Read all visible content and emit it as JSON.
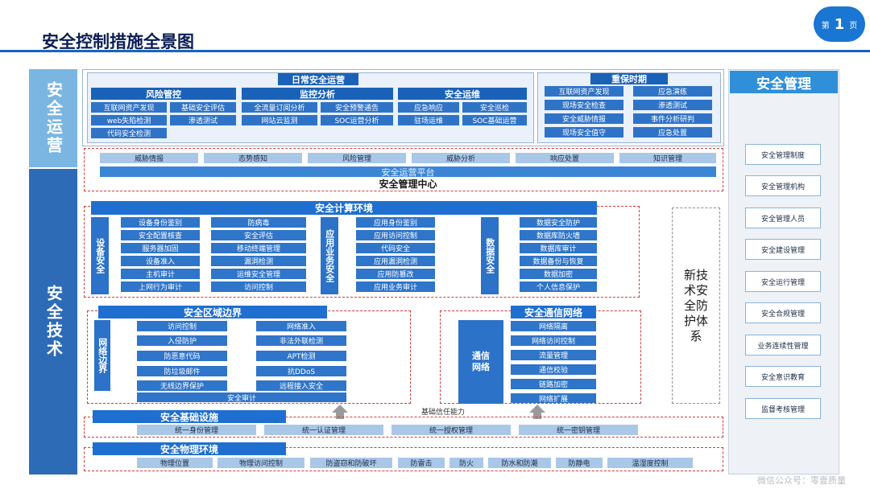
{
  "header": {
    "title": "安全控制措施全景图",
    "page_prefix": "第",
    "page_num": "1",
    "page_suffix": "页"
  },
  "bands": {
    "ops": "安全运营",
    "tech": "安全技术"
  },
  "daily_ops": {
    "title": "日常安全运营",
    "groups": [
      {
        "name": "风险管控",
        "items": [
          "互联网资产发现",
          "基础安全评估",
          "web失陷检测",
          "渗透测试",
          "代码安全检测"
        ]
      },
      {
        "name": "监控分析",
        "items": [
          "全流量订阅分析",
          "安全预警通告",
          "网站云监测",
          "SOC运营分析"
        ]
      },
      {
        "name": "安全运维",
        "items": [
          "应急响应",
          "安全巡检",
          "驻场运维",
          "SOC基础运营"
        ]
      }
    ]
  },
  "key_period": {
    "title": "重保时期",
    "items": [
      "互联网资产发现",
      "应急演练",
      "现场安全检查",
      "渗透测试",
      "安全威胁情报",
      "事件分析研判",
      "现场安全值守",
      "应急处置"
    ]
  },
  "soc": {
    "top_items": [
      "威胁情报",
      "态势感知",
      "风险管理",
      "威胁分析",
      "响应处置",
      "知识管理"
    ],
    "platform": "安全运营平台",
    "center": "安全管理中心"
  },
  "compute": {
    "title": "安全计算环境",
    "device": {
      "label": "设备安全",
      "col1": [
        "设备身份鉴别",
        "安全配置核查",
        "服务器加固",
        "设备准入",
        "主机审计",
        "上网行为审计"
      ],
      "col2": [
        "防病毒",
        "安全评估",
        "移动终端管理",
        "漏洞检测",
        "运维安全管理",
        "访问控制"
      ]
    },
    "app": {
      "label": "应用业务安全",
      "items": [
        "应用身份鉴别",
        "应用访问控制",
        "代码安全",
        "应用漏洞检测",
        "应用防篡改",
        "应用业务审计"
      ]
    },
    "data": {
      "label": "数据安全",
      "items": [
        "数据安全防护",
        "数据库防火墙",
        "数据库审计",
        "数据备份与恢复",
        "数据加密",
        "个人信息保护"
      ]
    }
  },
  "new_tech": "新技术安全防护体系",
  "border": {
    "title": "安全区域边界",
    "label": "网络边界",
    "col1": [
      "访问控制",
      "入侵防护",
      "防恶意代码",
      "防垃圾邮件",
      "无线边界保护"
    ],
    "col2": [
      "网络准入",
      "非法外联检测",
      "APT检测",
      "抗DDoS",
      "远程接入安全"
    ],
    "bottom": "安全审计"
  },
  "comm": {
    "title": "安全通信网络",
    "label": "通信网络",
    "items": [
      "网络隔离",
      "网络访问控制",
      "流量管理",
      "通信校验",
      "链路加密",
      "网络扩展"
    ]
  },
  "trust": "基础信任能力",
  "infra": {
    "title": "安全基础设施",
    "items": [
      "统一身份管理",
      "统一认证管理",
      "统一授权管理",
      "统一密钥管理"
    ]
  },
  "physical": {
    "title": "安全物理环境",
    "items": [
      "物理位置",
      "物理访问控制",
      "防盗窃和防破坏",
      "防雷击",
      "防火",
      "防水和防潮",
      "防静电",
      "温湿度控制"
    ]
  },
  "mgmt": {
    "title": "安全管理",
    "items": [
      "安全管理制度",
      "安全管理机构",
      "安全管理人员",
      "安全建设管理",
      "安全运行管理",
      "安全合规管理",
      "业务连续性管理",
      "安全意识教育",
      "监督考核管理"
    ]
  },
  "watermark": "微信公众号：零壹质量"
}
